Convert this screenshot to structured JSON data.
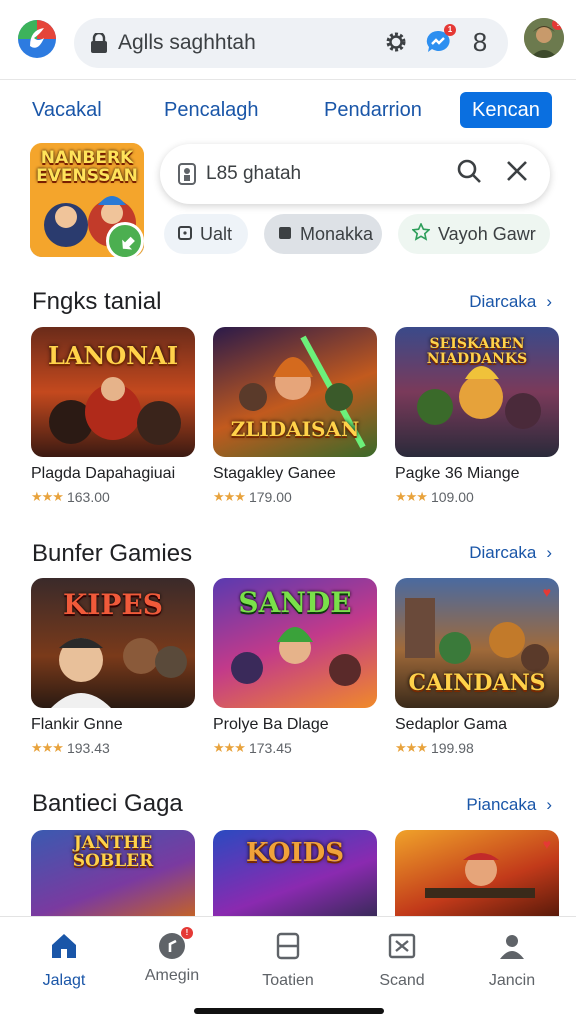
{
  "topbar": {
    "search_text": "Aglls saghhtah",
    "icons": [
      "app-logo",
      "lock-icon",
      "settings-icon",
      "messenger-icon",
      "account-number",
      "avatar"
    ],
    "account_digit": "8",
    "notif_badge": "1"
  },
  "tabs": [
    {
      "label": "Vacakal"
    },
    {
      "label": "Pencalagh"
    },
    {
      "label": "Pendarrion"
    },
    {
      "label": "Kencan",
      "active": true
    }
  ],
  "featured": {
    "title_art": "NANBERK EVENSSAN"
  },
  "search": {
    "text": "L85 ghatah"
  },
  "chips": [
    {
      "label": "Ualt",
      "icon": "square-icon"
    },
    {
      "label": "Monakka",
      "icon": "filled-square-icon"
    },
    {
      "label": "Vayoh Gawr",
      "icon": "star-outline-icon"
    }
  ],
  "sections": [
    {
      "title": "Fngks tanial",
      "more": "Diarcaka",
      "cards": [
        {
          "art": "LANONAI",
          "name": "Plagda Dapahagiuai",
          "rating": "163.00"
        },
        {
          "art": "ZLIDAISAN",
          "name": "Stagakley Ganee",
          "rating": "179.00"
        },
        {
          "art": "SEISKAREN NIADDANKS",
          "name": "Pagke 36 Miange",
          "rating": "109.00"
        }
      ]
    },
    {
      "title": "Bunfer Gamies",
      "more": "Diarcaka",
      "cards": [
        {
          "art": "KIPES",
          "name": "Flankir Gnne",
          "rating": "193.43"
        },
        {
          "art": "SANDE",
          "name": "Prolye Ba Dlage",
          "rating": "173.45"
        },
        {
          "art": "CAINDANS",
          "name": "Sedaplor Gama",
          "rating": "199.98"
        }
      ]
    },
    {
      "title": "Bantieci Gaga",
      "more": "Piancaka",
      "cards": [
        {
          "art": "JANTHE SOBLER"
        },
        {
          "art": "KOIDS"
        },
        {
          "art": ""
        }
      ]
    }
  ],
  "bottomnav": [
    {
      "label": "Jalagt",
      "icon": "home-icon",
      "active": true
    },
    {
      "label": "Amegin",
      "icon": "games-icon"
    },
    {
      "label": "Toatien",
      "icon": "apps-icon"
    },
    {
      "label": "Scand",
      "icon": "scan-icon"
    },
    {
      "label": "Jancin",
      "icon": "profile-icon"
    }
  ],
  "colors": {
    "accent": "#0a6fe0",
    "link": "#1a56a8",
    "badge": "#e53935",
    "star": "#e8a33d"
  }
}
